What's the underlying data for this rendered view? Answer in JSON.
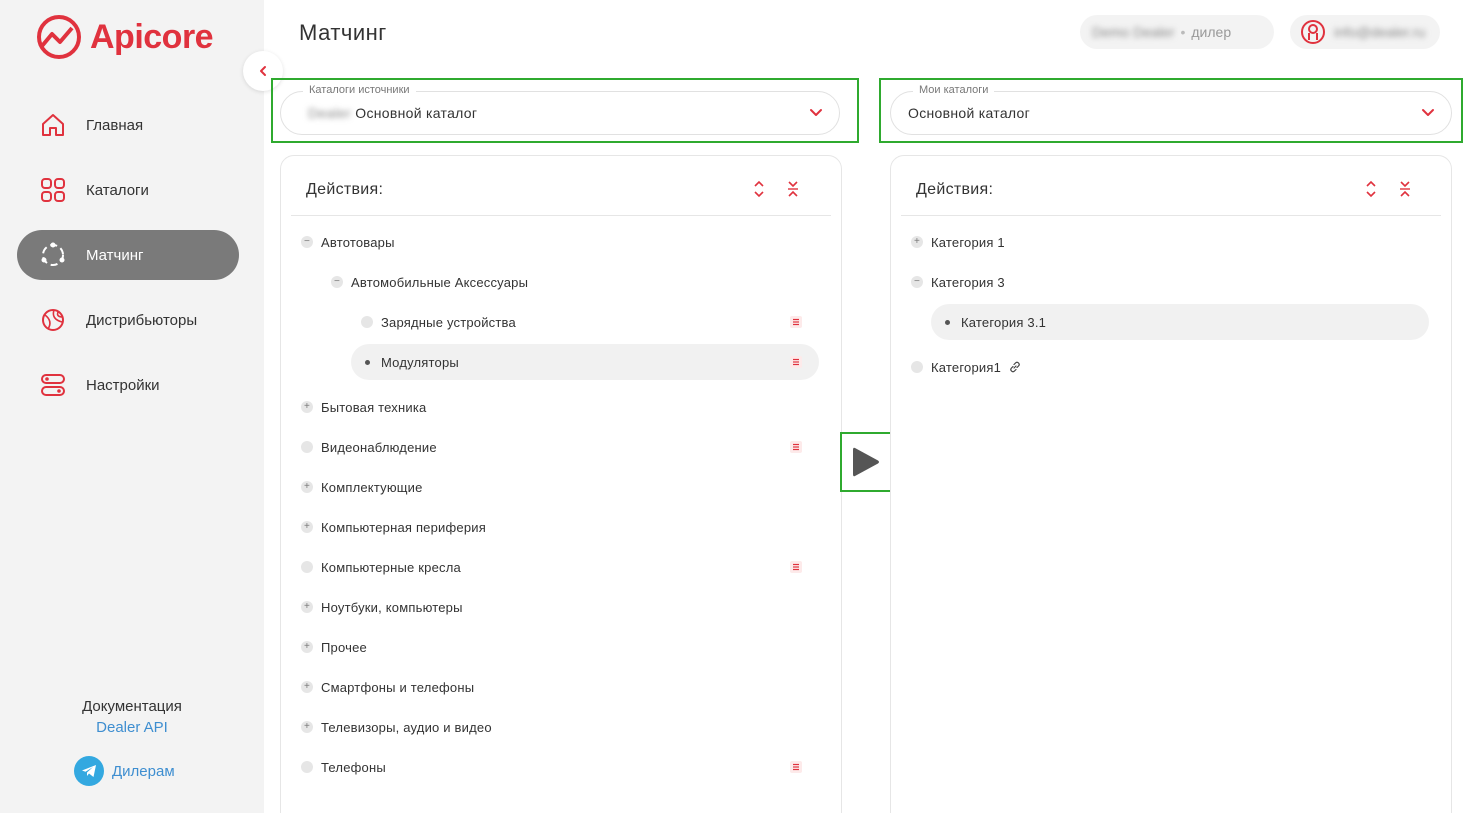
{
  "sidebar": {
    "logo_text": "Apicore",
    "nav": [
      {
        "label": "Главная",
        "icon": "home-icon",
        "active": false
      },
      {
        "label": "Каталоги",
        "icon": "grid-icon",
        "active": false
      },
      {
        "label": "Матчинг",
        "icon": "matching-icon",
        "active": true
      },
      {
        "label": "Дистрибьюторы",
        "icon": "globe-icon",
        "active": false
      },
      {
        "label": "Настройки",
        "icon": "settings-icon",
        "active": false
      }
    ],
    "docs_label": "Документация",
    "docs_link": "Dealer API",
    "telegram_label": "Дилерам"
  },
  "header": {
    "title": "Матчинг",
    "user_name": "Demo Dealer",
    "user_role": "дилер",
    "account_name": "info@dealer.ru"
  },
  "source_select": {
    "legend": "Каталоги источники",
    "prefix": "Dealer",
    "value": "Основной каталог"
  },
  "my_select": {
    "legend": "Мои каталоги",
    "value": "Основной каталог"
  },
  "left_panel": {
    "title": "Действия:",
    "rows": [
      {
        "label": "Автотовары",
        "level": 0,
        "toggle": "−",
        "doc": false
      },
      {
        "label": "Автомобильные Аксессуары",
        "level": 1,
        "toggle": "−",
        "doc": false
      },
      {
        "label": "Зарядные устройства",
        "level": 2,
        "toggle": "",
        "doc": true
      },
      {
        "label": "Модуляторы",
        "level": 2,
        "toggle": "dot",
        "doc": true,
        "selected": true
      },
      {
        "label": "Бытовая техника",
        "level": 0,
        "toggle": "+",
        "doc": false
      },
      {
        "label": "Видеонаблюдение",
        "level": 0,
        "toggle": "",
        "doc": true
      },
      {
        "label": "Комплектующие",
        "level": 0,
        "toggle": "+",
        "doc": false
      },
      {
        "label": "Компьютерная периферия",
        "level": 0,
        "toggle": "+",
        "doc": false
      },
      {
        "label": "Компьютерные кресла",
        "level": 0,
        "toggle": "",
        "doc": true
      },
      {
        "label": "Ноутбуки, компьютеры",
        "level": 0,
        "toggle": "+",
        "doc": false
      },
      {
        "label": "Прочее",
        "level": 0,
        "toggle": "+",
        "doc": false
      },
      {
        "label": "Смартфоны и телефоны",
        "level": 0,
        "toggle": "+",
        "doc": false
      },
      {
        "label": "Телевизоры, аудио и видео",
        "level": 0,
        "toggle": "+",
        "doc": false
      },
      {
        "label": "Телефоны",
        "level": 0,
        "toggle": "",
        "doc": true
      }
    ]
  },
  "right_panel": {
    "title": "Действия:",
    "rows": [
      {
        "label": "Категория 1",
        "level": 0,
        "toggle": "+"
      },
      {
        "label": "Категория 3",
        "level": 0,
        "toggle": "−"
      },
      {
        "label": "Категория 3.1",
        "level": 1,
        "toggle": "dot",
        "selected": true
      },
      {
        "label": "Категория1",
        "level": 0,
        "toggle": "",
        "link": true
      }
    ]
  },
  "colors": {
    "brand": "#e0323e",
    "highlight_frame": "#2faa2f",
    "active_nav": "#7a7a7a",
    "link": "#3e8ed0"
  }
}
